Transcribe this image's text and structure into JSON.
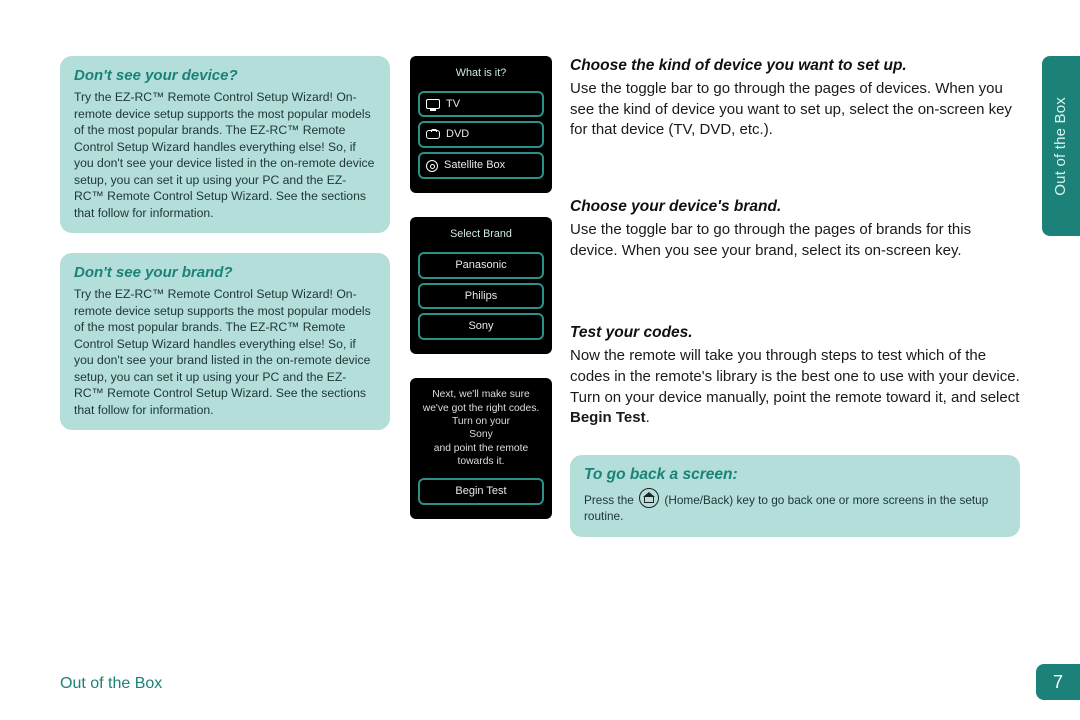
{
  "section_tab": "Out of the Box",
  "page_number": "7",
  "footer_section": "Out of the Box",
  "left": {
    "box1": {
      "heading": "Don't see your device?",
      "body": "Try the EZ-RC™ Remote Control Setup Wizard! On-remote device setup supports the most popular models of the most popular brands. The EZ-RC™ Remote Control Setup Wizard handles everything else! So, if you don't see your device listed in the on-remote device setup, you can set it up using your PC and the EZ-RC™ Remote Control Setup Wizard. See the sections that follow for information."
    },
    "box2": {
      "heading": "Don't see your brand?",
      "body": "Try the EZ-RC™ Remote Control Setup Wizard! On-remote device setup supports the most popular models of the most popular brands. The EZ-RC™ Remote Control Setup Wizard handles everything else! So, if you don't see your brand listed in the on-remote device setup, you can set it up using your PC and the EZ-RC™ Remote Control Setup Wizard. See the sections that follow for information."
    }
  },
  "remote1": {
    "title": "What is it?",
    "items": [
      "TV",
      "DVD",
      "Satellite Box"
    ]
  },
  "remote2": {
    "title": "Select Brand",
    "items": [
      "Panasonic",
      "Philips",
      "Sony"
    ]
  },
  "remote3": {
    "msg_line1": "Next, we'll make sure we've got the right codes. Turn on your",
    "msg_brand": "Sony",
    "msg_line2": "and point the remote towards it.",
    "action": "Begin Test"
  },
  "right": {
    "s1_h": "Choose the kind of device you want to set up.",
    "s1_p": "Use the toggle bar to go through the pages of devices. When you see the kind of device you want to set up, select the on-screen key for that device (TV, DVD, etc.).",
    "s2_h": "Choose your device's brand.",
    "s2_p": "Use the toggle bar to go through the pages of brands for this device. When you see your brand, select its on-screen key.",
    "s3_h": "Test your codes.",
    "s3_p_a": "Now the remote will take you through steps to test which of the codes in the remote's library is the best one to use with your device. Turn on your device manually, point the remote toward it, and select ",
    "s3_p_bold": "Begin Test",
    "s3_p_b": ".",
    "hint_h": "To go back a screen:",
    "hint_b_a": "Press the ",
    "hint_b_b": " (Home/Back) key to go back one or more screens in the setup routine."
  }
}
